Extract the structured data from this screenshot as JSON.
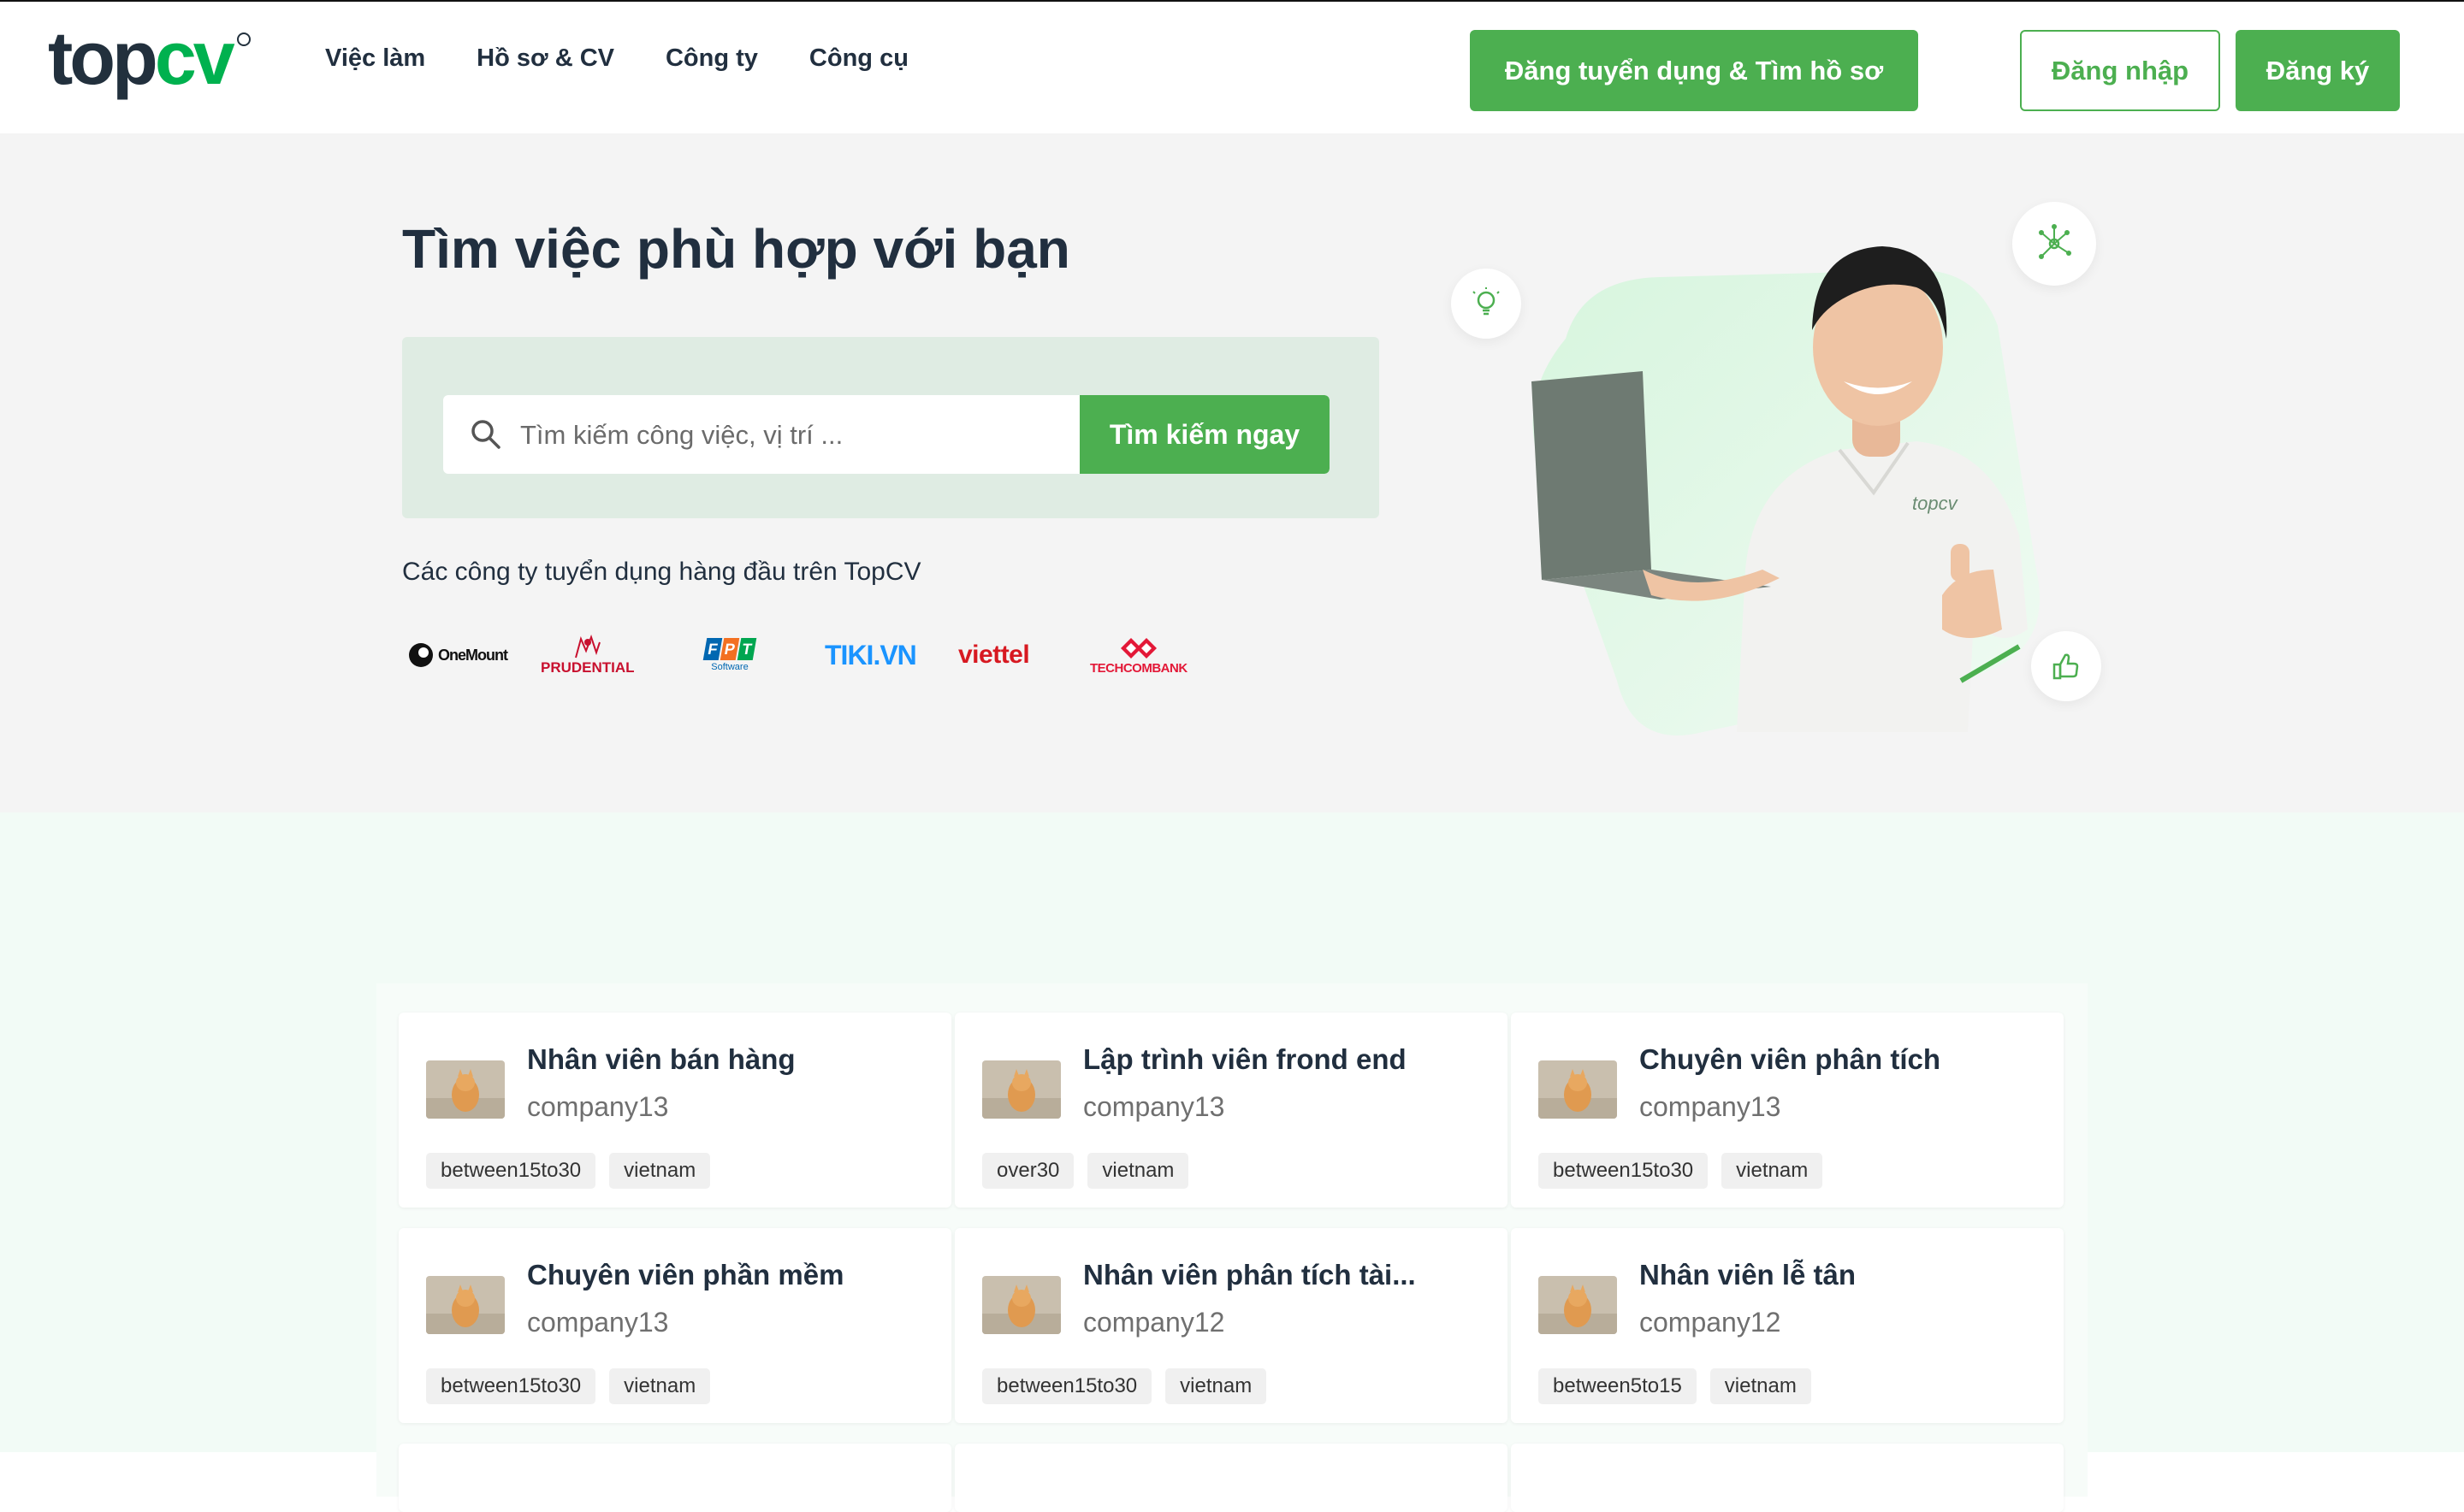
{
  "header": {
    "logo": {
      "part1": "top",
      "part2": "cv"
    },
    "nav": [
      "Việc làm",
      "Hồ sơ & CV",
      "Công ty",
      "Công cụ"
    ],
    "post_job_label": "Đăng tuyển dụng & Tìm hồ sơ",
    "login_label": "Đăng nhập",
    "register_label": "Đăng ký"
  },
  "hero": {
    "title": "Tìm việc phù hợp với bạn",
    "search": {
      "placeholder": "Tìm kiếm công việc, vị trí ...",
      "button_label": "Tìm kiếm ngay"
    },
    "top_companies_label": "Các công ty tuyển dụng hàng đầu trên TopCV",
    "companies": [
      {
        "name": "One Mount",
        "text": "OneMount"
      },
      {
        "name": "Prudential",
        "text": "PRUDENTIAL"
      },
      {
        "name": "FPT Software",
        "text": "FPT",
        "sub": "Software"
      },
      {
        "name": "Tiki",
        "text": "TIKI.VN"
      },
      {
        "name": "Viettel",
        "text": "viettel"
      },
      {
        "name": "Techcombank",
        "text": "TECHCOMBANK"
      }
    ],
    "shirt_logo": "topcv"
  },
  "jobs": [
    {
      "title": "Nhân viên bán hàng",
      "company": "company13",
      "tags": [
        "between15to30",
        "vietnam"
      ]
    },
    {
      "title": "Lập trình viên frond end",
      "company": "company13",
      "tags": [
        "over30",
        "vietnam"
      ]
    },
    {
      "title": "Chuyên viên phân tích",
      "company": "company13",
      "tags": [
        "between15to30",
        "vietnam"
      ]
    },
    {
      "title": "Chuyên viên phần mềm",
      "company": "company13",
      "tags": [
        "between15to30",
        "vietnam"
      ]
    },
    {
      "title": "Nhân viên phân tích tài...",
      "company": "company12",
      "tags": [
        "between15to30",
        "vietnam"
      ]
    },
    {
      "title": "Nhân viên lễ tân",
      "company": "company12",
      "tags": [
        "between5to15",
        "vietnam"
      ]
    }
  ],
  "colors": {
    "brand_green": "#4caf50",
    "logo_green": "#00b14f",
    "text_dark": "#212f3f",
    "hero_bg": "#f4f4f4",
    "section_bg": "#f2fbf6"
  }
}
